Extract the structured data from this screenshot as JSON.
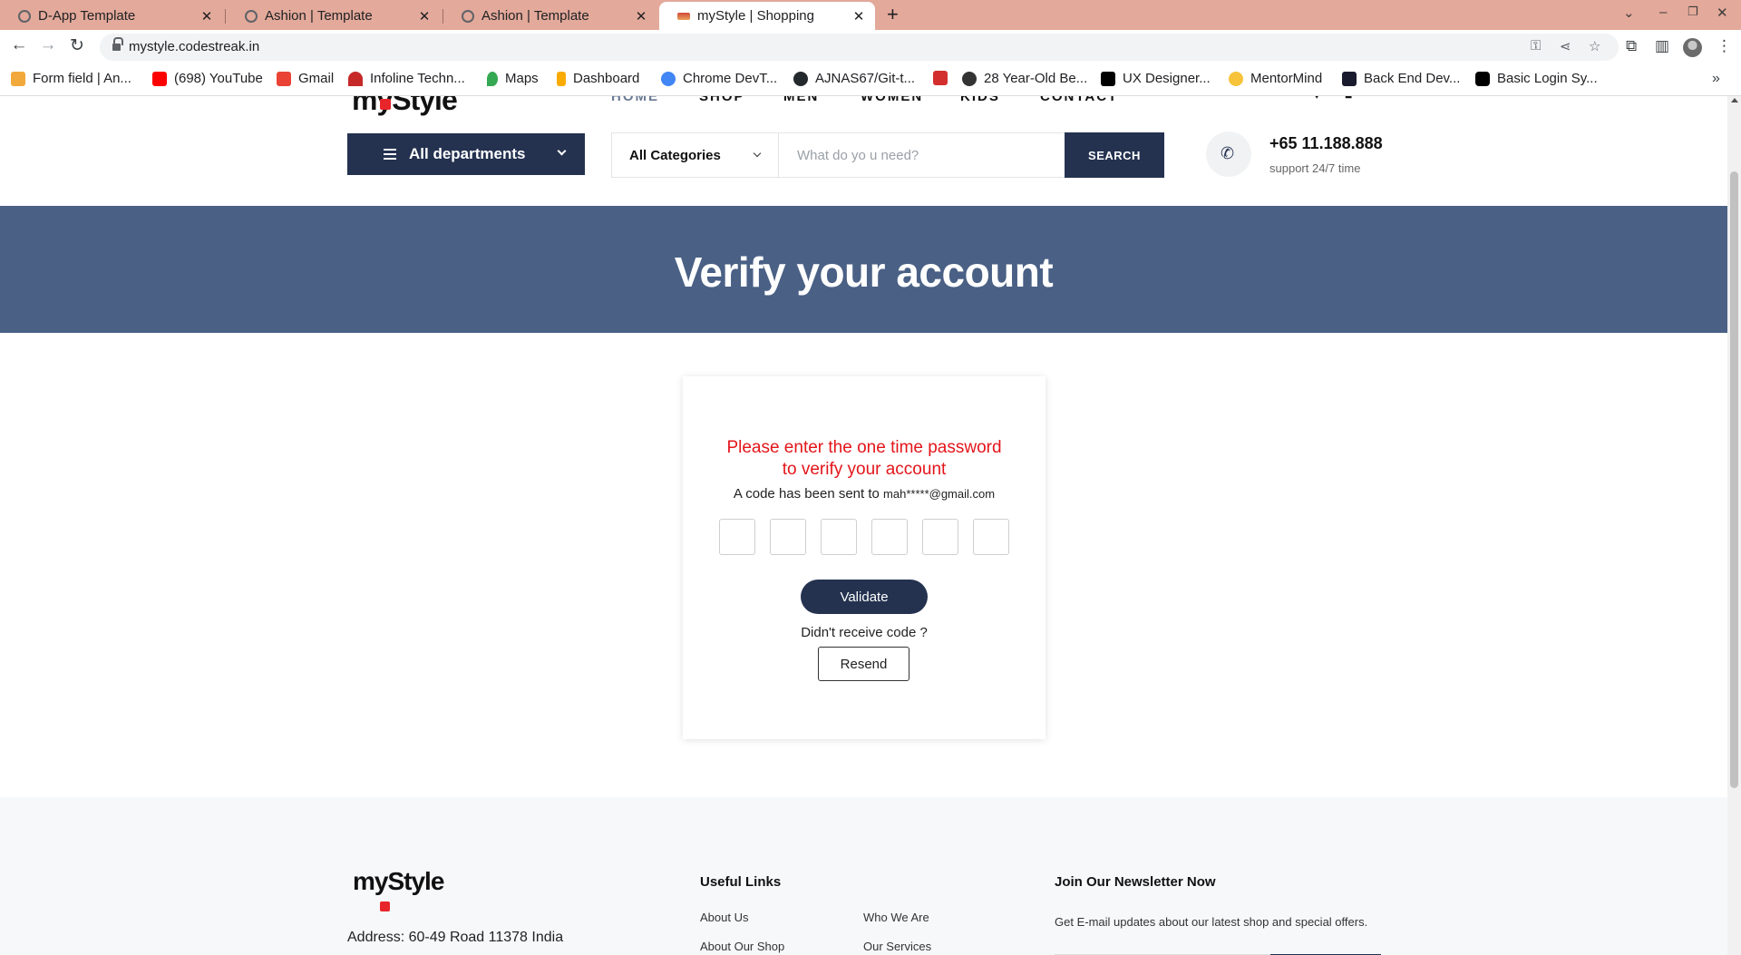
{
  "browser": {
    "tabs": [
      {
        "title": "D-App Template",
        "active": false
      },
      {
        "title": "Ashion | Template",
        "active": false
      },
      {
        "title": "Ashion | Template",
        "active": false
      },
      {
        "title": "myStyle | Shopping",
        "active": true
      }
    ],
    "url": "mystyle.codestreak.in",
    "bookmarks": [
      {
        "label": "Form field | An...",
        "icon": "angular-icon",
        "color": "#f2a93b"
      },
      {
        "label": "(698) YouTube",
        "icon": "youtube-icon",
        "color": "#ff0000"
      },
      {
        "label": "Gmail",
        "icon": "gmail-icon",
        "color": "#ea4335"
      },
      {
        "label": "Infoline Techn...",
        "icon": "infoline-icon",
        "color": "#c62828"
      },
      {
        "label": "Maps",
        "icon": "maps-icon",
        "color": "#34a853"
      },
      {
        "label": "Dashboard",
        "icon": "dashboard-icon",
        "color": "#f9ab00"
      },
      {
        "label": "Chrome DevT...",
        "icon": "chrome-icon",
        "color": "#4285f4"
      },
      {
        "label": "AJNAS67/Git-t...",
        "icon": "github-icon",
        "color": "#24292e"
      },
      {
        "label": "",
        "icon": "bookmark-red-icon",
        "color": "#d32f2f"
      },
      {
        "label": "28 Year-Old Be...",
        "icon": "globe-icon",
        "color": "#333333"
      },
      {
        "label": "UX Designer...",
        "icon": "wix-icon",
        "color": "#000000"
      },
      {
        "label": "MentorMind",
        "icon": "mentormind-icon",
        "color": "#f6c33b"
      },
      {
        "label": "Back End Dev...",
        "icon": "backend-icon",
        "color": "#1a1a2e"
      },
      {
        "label": "Basic Login Sy...",
        "icon": "medium-icon",
        "color": "#000000"
      }
    ]
  },
  "header": {
    "logo": "myStyle",
    "nav": [
      "HOME",
      "SHOP",
      "MEN",
      "WOMEN",
      "KIDS",
      "CONTACT"
    ],
    "departments_label": "All departments",
    "categories_label": "All Categories",
    "search_placeholder": "What do yo u need?",
    "search_button": "SEARCH",
    "phone": "+65 11.188.888",
    "support": "support 24/7 time"
  },
  "banner": {
    "title": "Verify your account"
  },
  "otp": {
    "heading_line1": "Please enter the one time password",
    "heading_line2": "to verify your account",
    "sent_text": "A code has been sent to",
    "email": "mah*****@gmail.com",
    "digits": [
      "",
      "",
      "",
      "",
      "",
      ""
    ],
    "validate_label": "Validate",
    "didnt_receive": "Didn't receive code ?",
    "resend_label": "Resend"
  },
  "footer": {
    "logo": "myStyle",
    "address": "Address: 60-49 Road 11378 India",
    "useful_links_heading": "Useful Links",
    "links_col1": [
      "About Us",
      "About Our Shop"
    ],
    "links_col2": [
      "Who We Are",
      "Our Services"
    ],
    "newsletter_heading": "Join Our Newsletter Now",
    "newsletter_text": "Get E-mail updates about our latest shop and special offers."
  },
  "colors": {
    "brand_navy": "#243250",
    "banner_blue": "#4a6085",
    "error_red": "#e3151a",
    "tabbar": "#e3a99a"
  }
}
